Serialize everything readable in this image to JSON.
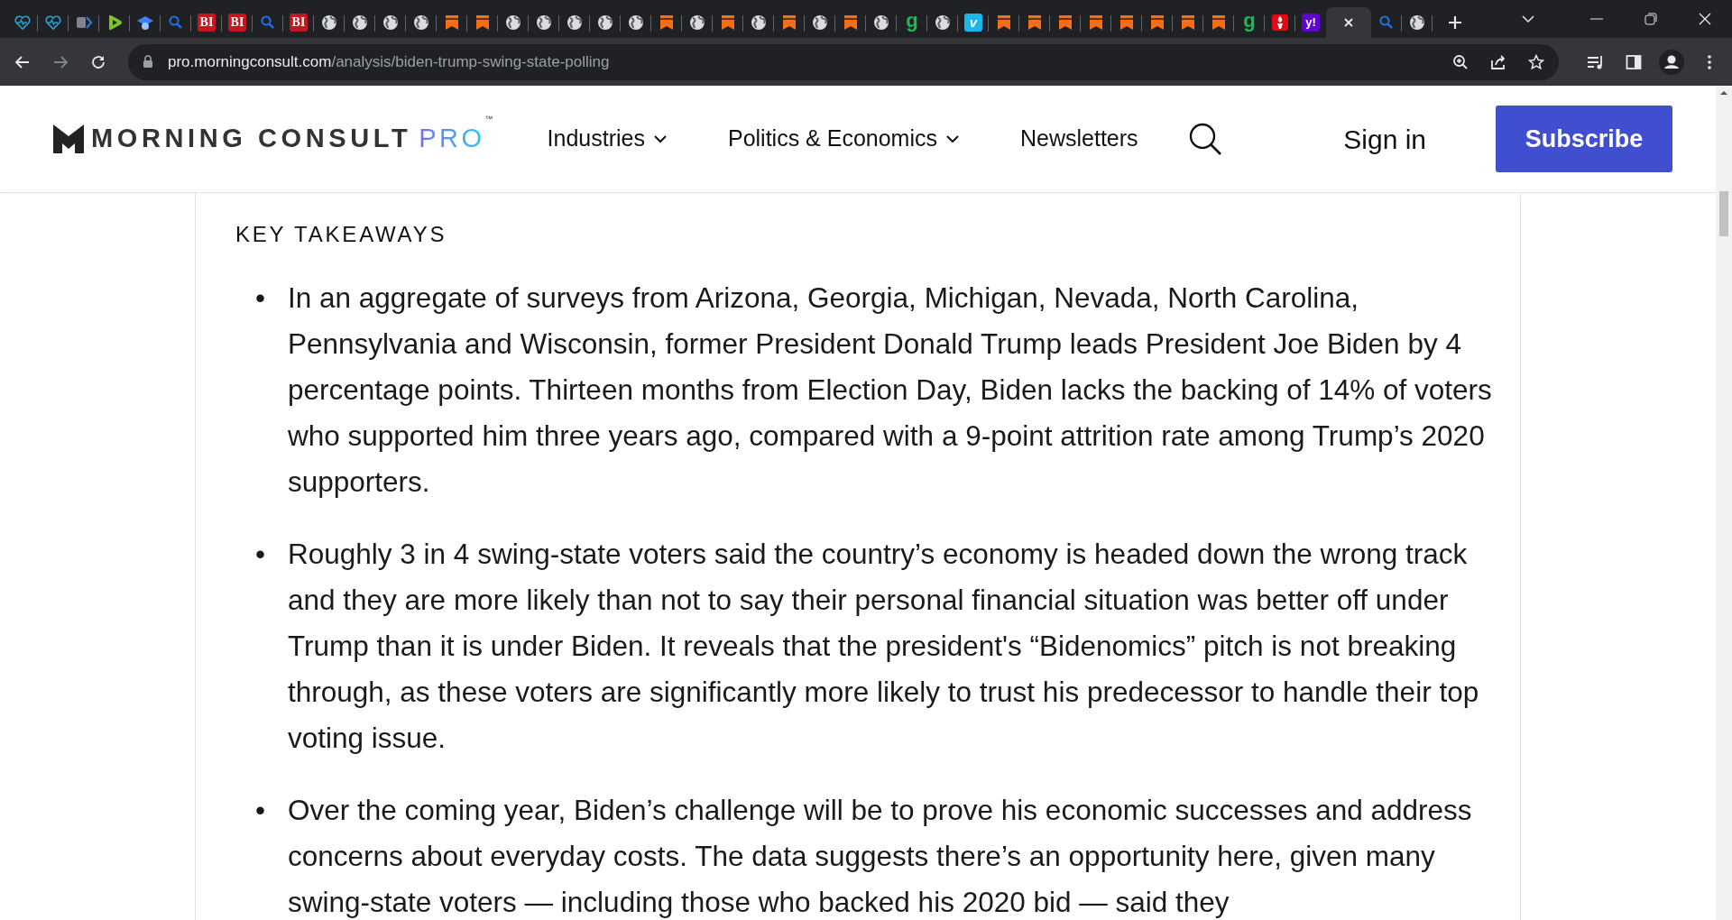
{
  "browser": {
    "tabs": [
      {
        "kind": "heart",
        "selected": false
      },
      {
        "kind": "heart",
        "selected": false
      },
      {
        "kind": "arrow",
        "selected": false
      },
      {
        "kind": "play",
        "selected": false
      },
      {
        "kind": "cap",
        "selected": false
      },
      {
        "kind": "search",
        "selected": false
      },
      {
        "kind": "bi",
        "label": "BI",
        "selected": false
      },
      {
        "kind": "bi",
        "label": "BI",
        "selected": false
      },
      {
        "kind": "search",
        "selected": false
      },
      {
        "kind": "bi",
        "label": "BI",
        "selected": false
      },
      {
        "kind": "globe",
        "selected": false
      },
      {
        "kind": "globe",
        "selected": false
      },
      {
        "kind": "globe",
        "selected": false
      },
      {
        "kind": "globe",
        "selected": false
      },
      {
        "kind": "bookmark",
        "selected": false
      },
      {
        "kind": "bookmark",
        "selected": false
      },
      {
        "kind": "globe",
        "selected": false
      },
      {
        "kind": "globe",
        "selected": false
      },
      {
        "kind": "globe",
        "selected": false
      },
      {
        "kind": "globe",
        "selected": false
      },
      {
        "kind": "globe",
        "selected": false
      },
      {
        "kind": "bookmark",
        "selected": false
      },
      {
        "kind": "globe",
        "selected": false
      },
      {
        "kind": "bookmark",
        "selected": false
      },
      {
        "kind": "globe",
        "selected": false
      },
      {
        "kind": "bookmark",
        "selected": false
      },
      {
        "kind": "globe",
        "selected": false
      },
      {
        "kind": "bookmark",
        "selected": false
      },
      {
        "kind": "globe",
        "selected": false
      },
      {
        "kind": "g",
        "label": "g",
        "selected": false
      },
      {
        "kind": "globe",
        "selected": false
      },
      {
        "kind": "v",
        "label": "v",
        "selected": false
      },
      {
        "kind": "bookmark",
        "selected": false
      },
      {
        "kind": "bookmark",
        "selected": false
      },
      {
        "kind": "bookmark",
        "selected": false
      },
      {
        "kind": "bookmark",
        "selected": false
      },
      {
        "kind": "bookmark",
        "selected": false
      },
      {
        "kind": "bookmark",
        "selected": false
      },
      {
        "kind": "bookmark",
        "selected": false
      },
      {
        "kind": "bookmark",
        "selected": false
      },
      {
        "kind": "g",
        "label": "g",
        "selected": false
      },
      {
        "kind": "fire",
        "selected": false
      },
      {
        "kind": "yahoo",
        "label": "y!",
        "selected": false
      },
      {
        "selected": true
      },
      {
        "kind": "search",
        "selected": false
      },
      {
        "kind": "globe",
        "selected": false
      }
    ],
    "address": {
      "host": "pro.morningconsult.com",
      "path": "/analysis/biden-trump-swing-state-polling"
    }
  },
  "header": {
    "brand": "MORNING CONSULT",
    "suffix": "PRO",
    "trademark": "™",
    "nav": [
      {
        "label": "Industries",
        "dropdown": true
      },
      {
        "label": "Politics & Economics",
        "dropdown": true
      },
      {
        "label": "Newsletters",
        "dropdown": false
      }
    ],
    "sign_in": "Sign in",
    "subscribe": "Subscribe"
  },
  "article": {
    "heading": "KEY TAKEAWAYS",
    "bullets": [
      {
        "marker": "•",
        "text": "In an aggregate of surveys from Arizona, Georgia, Michigan, Nevada, North Carolina, Pennsylvania and Wisconsin, former President Donald Trump leads President Joe Biden by 4 percentage points. Thirteen months from Election Day, Biden lacks the backing of 14% of voters who supported him three years ago, compared with a 9-point attrition rate among Trump’s 2020 supporters."
      },
      {
        "marker": "•",
        "text": "Roughly 3 in 4 swing-state voters said the country’s economy is headed down the wrong track and they are more likely than not to say their personal financial situation was better off under Trump than it is under Biden. It reveals that the president's “Bidenomics” pitch is not breaking through, as these voters are significantly more likely to trust his predecessor to handle their top voting issue."
      },
      {
        "marker": "•",
        "text": "Over the coming year, Biden’s challenge will be to prove his economic successes and address concerns about everyday costs. The data suggests there’s an opportunity here, given many swing-state voters — including those who backed his 2020 bid — said they"
      }
    ]
  }
}
